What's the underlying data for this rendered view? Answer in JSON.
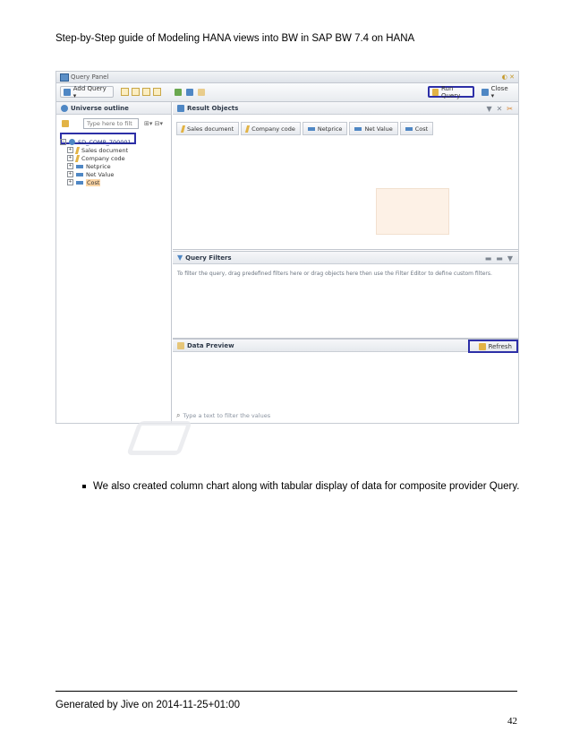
{
  "header": {
    "title": "Step-by-Step guide of Modeling HANA views into BW in SAP BW 7.4 on HANA"
  },
  "window": {
    "title": "Query Panel",
    "toolbar": {
      "add_query": "Add Query ▾",
      "run_query": "Run Query",
      "close": "Close ▾"
    },
    "universe_outline": {
      "title": "Universe outline",
      "search_placeholder": "Type here to filt",
      "root": "SD_COMP_700001",
      "items": [
        {
          "label": "Sales document",
          "kind": "dimension"
        },
        {
          "label": "Company code",
          "kind": "dimension"
        },
        {
          "label": "Netprice",
          "kind": "measure"
        },
        {
          "label": "Net Value",
          "kind": "measure"
        },
        {
          "label": "Cost",
          "kind": "measure"
        }
      ]
    },
    "result_objects": {
      "title": "Result Objects",
      "objects": [
        {
          "label": "Sales document",
          "kind": "dimension"
        },
        {
          "label": "Company code",
          "kind": "dimension"
        },
        {
          "label": "Netprice",
          "kind": "measure"
        },
        {
          "label": "Net Value",
          "kind": "measure"
        },
        {
          "label": "Cost",
          "kind": "measure"
        }
      ]
    },
    "query_filters": {
      "title": "Query Filters",
      "hint": "To filter the query, drag predefined filters here or drag objects here then use the Filter Editor to define custom filters."
    },
    "data_preview": {
      "title": "Data Preview",
      "refresh": "Refresh",
      "search_placeholder": "Type a text to filter the values"
    }
  },
  "body": {
    "bullet": "We also created column chart along with tabular display of data for composite provider Query."
  },
  "footer": {
    "generated": "Generated by Jive on 2014-11-25+01:00",
    "page_number": "42"
  }
}
